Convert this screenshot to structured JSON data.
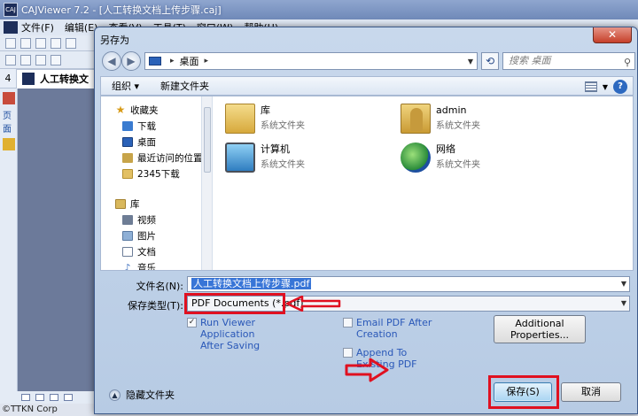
{
  "app": {
    "title": "CAJViewer 7.2 - [人工转换文档上传步骤.caj]",
    "logo_text": "CAJ",
    "menu": [
      "文件(F)",
      "编辑(E)",
      "查看(V)",
      "工具(T)",
      "窗口(W)",
      "帮助(H)"
    ],
    "tab_number": "4",
    "tab_label": "人工转换文",
    "side_label": "页面",
    "footer": "©TTKN Corp"
  },
  "dialog": {
    "title": "另存为",
    "close_label": "✕",
    "address": {
      "location": "桌面",
      "separator": "▸"
    },
    "search_placeholder": "搜索 桌面",
    "command_bar": {
      "organize": "组织 ▾",
      "new_folder": "新建文件夹"
    },
    "tree": {
      "favorites_header": "收藏夹",
      "favorites": [
        "下载",
        "桌面",
        "最近访问的位置",
        "2345下载"
      ],
      "libraries_header": "库",
      "libraries": [
        "视频",
        "图片",
        "文档",
        "音乐"
      ]
    },
    "items": [
      {
        "name": "库",
        "type": "系统文件夹",
        "icon": "library-icon"
      },
      {
        "name": "admin",
        "type": "系统文件夹",
        "icon": "user-folder-icon"
      },
      {
        "name": "计算机",
        "type": "系统文件夹",
        "icon": "computer-icon"
      },
      {
        "name": "网络",
        "type": "系统文件夹",
        "icon": "network-icon"
      }
    ],
    "filename_label": "文件名(N):",
    "filename_value": "人工转换文档上传步骤.pdf",
    "filetype_label": "保存类型(T):",
    "filetype_value": "PDF Documents (*.pdf)",
    "options": {
      "run_viewer": "Run Viewer Application After Saving",
      "run_viewer_checked": true,
      "email_pdf": "Email PDF After Creation",
      "email_pdf_checked": false,
      "append": "Append To Existing PDF",
      "append_checked": false,
      "additional_properties": "Additional Properties..."
    },
    "hide_folders": "隐藏文件夹",
    "save_button": "保存(S)",
    "cancel_button": "取消"
  },
  "colors": {
    "annotation_red": "#e01020",
    "link_blue": "#2a58b8",
    "selection_blue": "#3875d7"
  }
}
